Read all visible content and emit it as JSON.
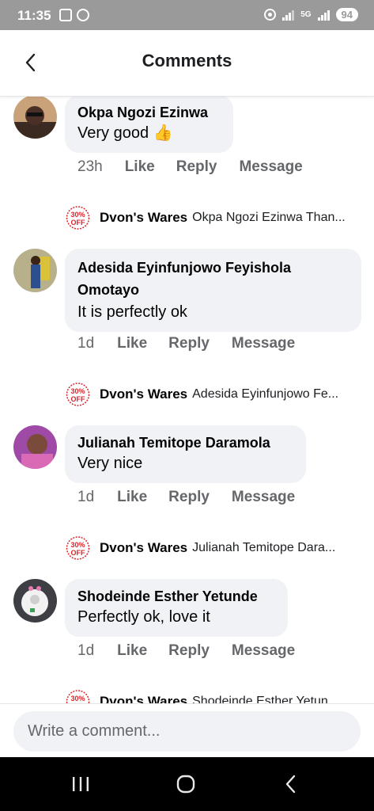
{
  "status_bar": {
    "time": "11:35",
    "battery": "94",
    "network": "5G"
  },
  "header": {
    "title": "Comments"
  },
  "comments": [
    {
      "author": "Okpa Ngozi Ezinwa",
      "text": "Very good 👍",
      "time": "23h",
      "like": "Like",
      "reply": "Reply",
      "message": "Message",
      "reply_preview": {
        "author": "Dvon's Wares",
        "text": "Okpa Ngozi Ezinwa Than..."
      }
    },
    {
      "author": "Adesida Eyinfunjowo Feyishola Omotayo",
      "text": "It is perfectly ok",
      "time": "1d",
      "like": "Like",
      "reply": "Reply",
      "message": "Message",
      "reply_preview": {
        "author": "Dvon's Wares",
        "text": "Adesida Eyinfunjowo Fe..."
      }
    },
    {
      "author": "Julianah Temitope Daramola",
      "text": "Very nice",
      "time": "1d",
      "like": "Like",
      "reply": "Reply",
      "message": "Message",
      "reply_preview": {
        "author": "Dvon's Wares",
        "text": "Julianah Temitope Dara..."
      }
    },
    {
      "author": "Shodeinde Esther Yetunde",
      "text": "Perfectly ok, love it",
      "time": "1d",
      "like": "Like",
      "reply": "Reply",
      "message": "Message",
      "reply_preview": {
        "author": "Dvon's Wares",
        "text": "Shodeinde Esther Yetun..."
      }
    }
  ],
  "logo_text": {
    "line1": "30%",
    "line2": "OFF"
  },
  "input": {
    "placeholder": "Write a comment..."
  },
  "icons": {
    "back": "chevron-left-icon",
    "nav_recent": "recent-apps-icon",
    "nav_home": "home-icon",
    "nav_back": "nav-back-icon"
  },
  "colors": {
    "bubble": "#f0f2f5",
    "secondary_text": "#65676b",
    "logo_red": "#d9262c",
    "status_bar": "#9a9a9a"
  }
}
